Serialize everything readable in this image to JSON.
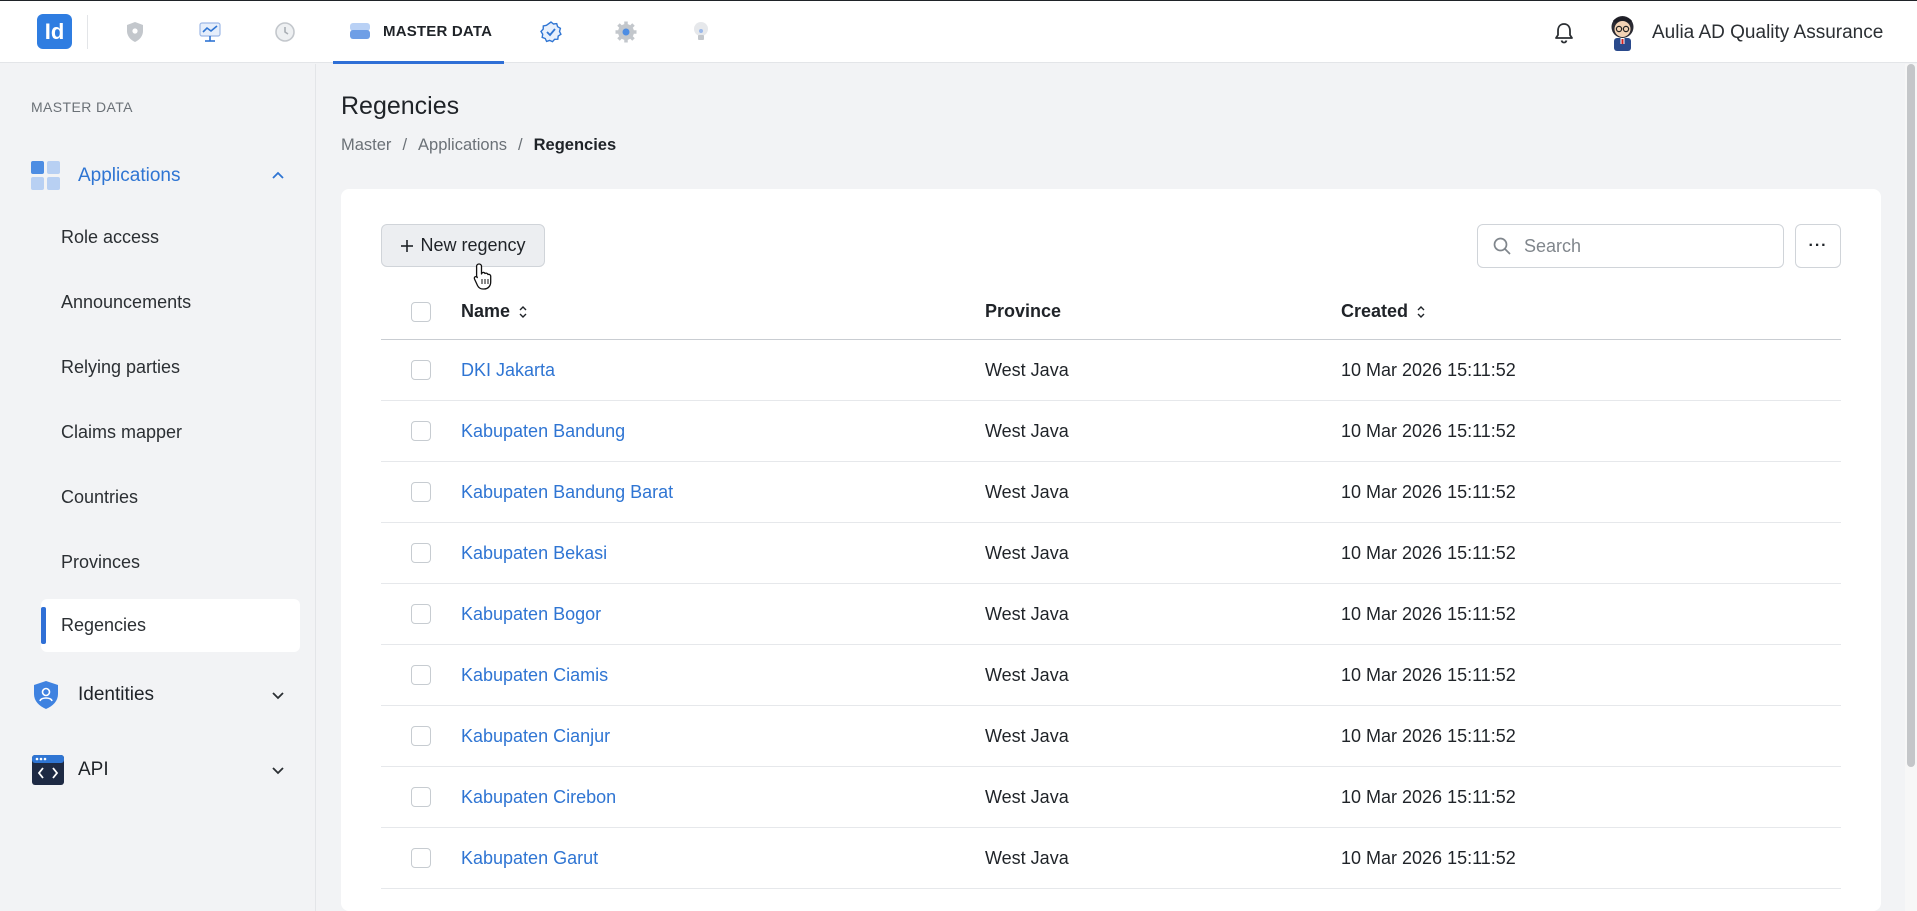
{
  "topbar": {
    "logo_text": "Id",
    "active_tab_label": "MASTER DATA",
    "user_name": "Aulia AD Quality Assurance",
    "nav_icons": [
      "shield-icon",
      "dashboard-icon",
      "history-icon",
      "database-icon",
      "check-badge-icon",
      "gear-icon",
      "bulb-icon"
    ]
  },
  "sidebar": {
    "section_title": "MASTER DATA",
    "groups": [
      {
        "label": "Applications",
        "expanded": true,
        "icon": "apps-grid-icon"
      },
      {
        "label": "Identities",
        "expanded": false,
        "icon": "identity-shield-icon"
      },
      {
        "label": "API",
        "expanded": false,
        "icon": "api-code-icon"
      }
    ],
    "items": [
      "Role access",
      "Announcements",
      "Relying parties",
      "Claims mapper",
      "Countries",
      "Provinces",
      "Regencies"
    ],
    "active_item": "Regencies"
  },
  "page": {
    "title": "Regencies",
    "breadcrumb": [
      "Master",
      "Applications",
      "Regencies"
    ]
  },
  "toolbar": {
    "new_button_label": "New regency",
    "search_placeholder": "Search",
    "more_label": "···"
  },
  "table": {
    "columns": {
      "name": "Name",
      "province": "Province",
      "created": "Created"
    },
    "rows": [
      {
        "name": "DKI Jakarta",
        "province": "West Java",
        "created": "10 Mar 2026 15:11:52"
      },
      {
        "name": "Kabupaten Bandung",
        "province": "West Java",
        "created": "10 Mar 2026 15:11:52"
      },
      {
        "name": "Kabupaten Bandung Barat",
        "province": "West Java",
        "created": "10 Mar 2026 15:11:52"
      },
      {
        "name": "Kabupaten Bekasi",
        "province": "West Java",
        "created": "10 Mar 2026 15:11:52"
      },
      {
        "name": "Kabupaten Bogor",
        "province": "West Java",
        "created": "10 Mar 2026 15:11:52"
      },
      {
        "name": "Kabupaten Ciamis",
        "province": "West Java",
        "created": "10 Mar 2026 15:11:52"
      },
      {
        "name": "Kabupaten Cianjur",
        "province": "West Java",
        "created": "10 Mar 2026 15:11:52"
      },
      {
        "name": "Kabupaten Cirebon",
        "province": "West Java",
        "created": "10 Mar 2026 15:11:52"
      },
      {
        "name": "Kabupaten Garut",
        "province": "West Java",
        "created": "10 Mar 2026 15:11:52"
      }
    ]
  },
  "colors": {
    "accent": "#2f6fd6",
    "link": "#2f75d3",
    "background": "#f2f3f5"
  }
}
